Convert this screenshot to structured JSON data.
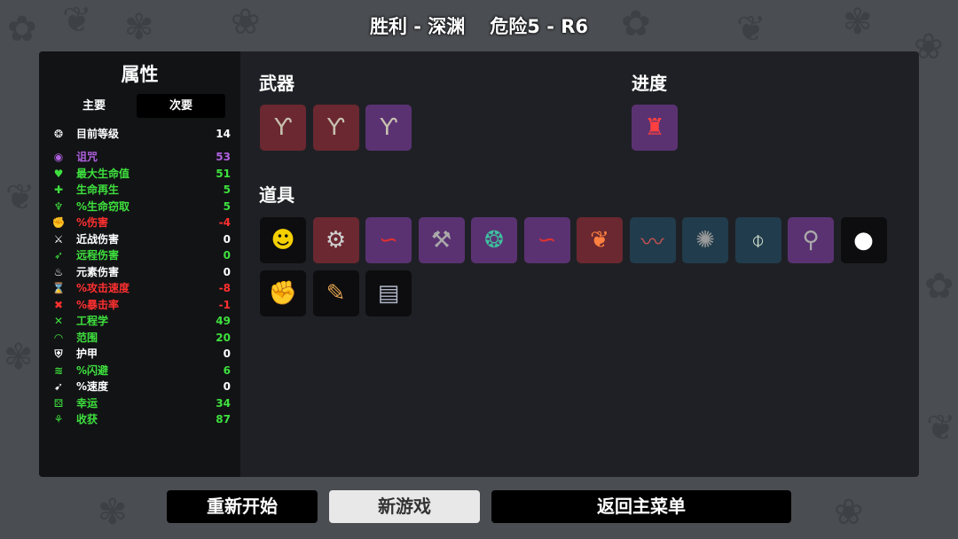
{
  "header": {
    "result": "胜利 - 深渊",
    "difficulty": "危险5 - R6"
  },
  "stats": {
    "title": "属性",
    "tabs": {
      "primary": "主要",
      "secondary": "次要"
    },
    "level": {
      "icon": "level-icon",
      "label": "目前等级",
      "value": "14",
      "color": "#ffffff"
    },
    "items": [
      {
        "icon": "curse-eye-icon",
        "label": "诅咒",
        "value": "53",
        "color": "#b060e0"
      },
      {
        "icon": "heart-icon",
        "label": "最大生命值",
        "value": "51",
        "color": "#3ee03e"
      },
      {
        "icon": "heart-plus-icon",
        "label": "生命再生",
        "value": "5",
        "color": "#3ee03e"
      },
      {
        "icon": "fang-icon",
        "label": "%生命窃取",
        "value": "5",
        "color": "#3ee03e"
      },
      {
        "icon": "muscle-icon",
        "label": "%伤害",
        "value": "-4",
        "color": "#ff3030"
      },
      {
        "icon": "sword-icon",
        "label": "近战伤害",
        "value": "0",
        "color": "#ffffff"
      },
      {
        "icon": "bow-icon",
        "label": "远程伤害",
        "value": "0",
        "color": "#3ee03e"
      },
      {
        "icon": "flame-icon",
        "label": "元素伤害",
        "value": "0",
        "color": "#ffffff"
      },
      {
        "icon": "hourglass-icon",
        "label": "%攻击速度",
        "value": "-8",
        "color": "#ff3030"
      },
      {
        "icon": "crit-icon",
        "label": "%暴击率",
        "value": "-1",
        "color": "#ff3030"
      },
      {
        "icon": "wrench-icon",
        "label": "工程学",
        "value": "49",
        "color": "#3ee03e"
      },
      {
        "icon": "range-icon",
        "label": "范围",
        "value": "20",
        "color": "#3ee03e"
      },
      {
        "icon": "shield-icon",
        "label": "护甲",
        "value": "0",
        "color": "#ffffff"
      },
      {
        "icon": "dodge-icon",
        "label": "%闪避",
        "value": "6",
        "color": "#3ee03e"
      },
      {
        "icon": "boot-icon",
        "label": "%速度",
        "value": "0",
        "color": "#ffffff"
      },
      {
        "icon": "dice-icon",
        "label": "幸运",
        "value": "34",
        "color": "#3ee03e"
      },
      {
        "icon": "harvest-icon",
        "label": "收获",
        "value": "87",
        "color": "#3ee03e"
      }
    ]
  },
  "weapons": {
    "title": "武器",
    "items": [
      {
        "icon": "slingshot-icon",
        "tier": "red"
      },
      {
        "icon": "slingshot-icon",
        "tier": "red"
      },
      {
        "icon": "slingshot-icon",
        "tier": "purple"
      }
    ]
  },
  "progress": {
    "title": "进度",
    "items": [
      {
        "icon": "lighthouse-icon",
        "tier": "purple"
      }
    ]
  },
  "inventory": {
    "title": "道具",
    "items": [
      {
        "icon": "hardhat-face-icon",
        "tier": "black"
      },
      {
        "icon": "robot-icon",
        "tier": "red"
      },
      {
        "icon": "scarf-icon",
        "tier": "purple"
      },
      {
        "icon": "axe-icon",
        "tier": "purple"
      },
      {
        "icon": "peacock-icon",
        "tier": "purple"
      },
      {
        "icon": "scarf-icon",
        "tier": "purple"
      },
      {
        "icon": "rainbow-leaf-icon",
        "tier": "red"
      },
      {
        "icon": "bacon-icon",
        "tier": "blue"
      },
      {
        "icon": "gear-icon",
        "tier": "blue"
      },
      {
        "icon": "flashlight-icon",
        "tier": "blue"
      },
      {
        "icon": "lamp-icon",
        "tier": "purple"
      },
      {
        "icon": "snowball-icon",
        "tier": "black"
      },
      {
        "icon": "gauntlet-icon",
        "tier": "black"
      },
      {
        "icon": "pencil-icon",
        "tier": "black"
      },
      {
        "icon": "book-icon",
        "tier": "black"
      }
    ]
  },
  "buttons": {
    "restart": "重新开始",
    "new_game": "新游戏",
    "main_menu": "返回主菜单"
  }
}
